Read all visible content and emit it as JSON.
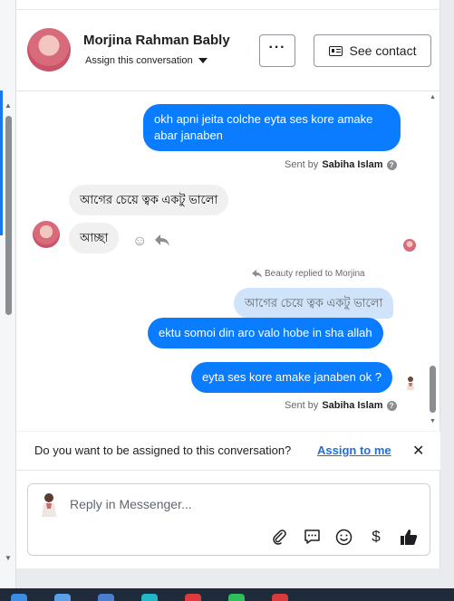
{
  "header": {
    "name": "Morjina Rahman Bably",
    "assign_label": "Assign this conversation",
    "more_label": "···",
    "see_contact_label": "See contact"
  },
  "messages": [
    {
      "dir": "out",
      "text": "okh apni jeita colche eyta ses kore amake abar janaben"
    },
    {
      "dir": "meta",
      "sent_by_prefix": "Sent by",
      "sent_by_name": "Sabiha Islam"
    },
    {
      "dir": "in",
      "text": "আগের চেয়ে ত্বক একটু ভালো"
    },
    {
      "dir": "in",
      "text": "আচ্ছা"
    },
    {
      "dir": "note",
      "text": "Beauty replied to Morjina"
    },
    {
      "dir": "quoted",
      "text": "আগের চেয়ে ত্বক একটু ভালো"
    },
    {
      "dir": "out",
      "text": "ektu somoi din aro valo hobe in sha allah"
    },
    {
      "dir": "out",
      "text": "eyta ses kore amake janaben ok ?"
    },
    {
      "dir": "meta",
      "sent_by_prefix": "Sent by",
      "sent_by_name": "Sabiha Islam"
    }
  ],
  "assign_banner": {
    "question": "Do you want to be assigned to this conversation?",
    "link": "Assign to me",
    "close": "✕"
  },
  "composer": {
    "placeholder": "Reply in Messenger..."
  },
  "icons": {
    "help": "?",
    "emoji": "☺",
    "dollar": "$",
    "like": "👍"
  },
  "colors": {
    "outgoing_bubble": "#0a7cff",
    "incoming_bubble": "#f0f0f0",
    "quoted_bubble": "#cfe3fb",
    "link": "#216fdb"
  }
}
